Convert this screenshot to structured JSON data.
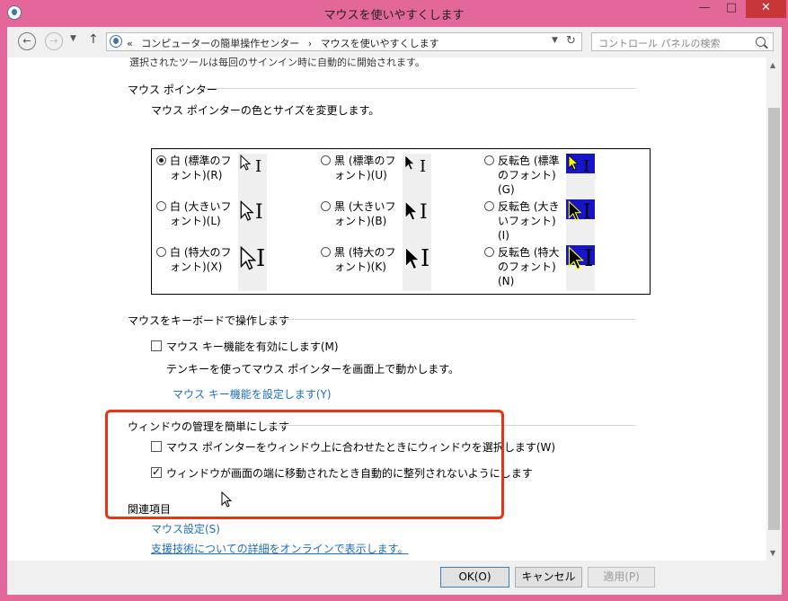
{
  "window": {
    "title": "マウスを使いやすくします",
    "controls": {
      "minimize": "—",
      "maximize": "□",
      "close": "✕"
    }
  },
  "address_bar": {
    "path_prefix": "«",
    "crumbs": [
      "コンピューターの簡単操作センター",
      "マウスを使いやすくします"
    ],
    "separator": "›",
    "search_placeholder": "コントロール パネルの検索"
  },
  "content": {
    "cut_text": "選択されたツールは毎回のサインイン時に自動的に開始されます。",
    "pointer_section": {
      "title": "マウス ポインター",
      "subtitle": "マウス ポインターの色とサイズを変更します。",
      "options": [
        {
          "label": "白 (標準のフォント)(R)",
          "selected": true
        },
        {
          "label": "黒 (標準のフォント)(U)",
          "selected": false
        },
        {
          "label": "反転色 (標準のフォント)(G)",
          "selected": false
        },
        {
          "label": "白 (大きいフォント)(L)",
          "selected": false
        },
        {
          "label": "黒 (大きいフォント)(B)",
          "selected": false
        },
        {
          "label": "反転色 (大きいフォント)(I)",
          "selected": false
        },
        {
          "label": "白 (特大のフォント)(X)",
          "selected": false
        },
        {
          "label": "黒 (特大のフォント)(K)",
          "selected": false
        },
        {
          "label": "反転色 (特大のフォント)(N)",
          "selected": false
        }
      ]
    },
    "keyboard_section": {
      "title": "マウスをキーボードで操作します",
      "mousekeys_label": "マウス キー機能を有効にします(M)",
      "mousekeys_checked": false,
      "desc": "テンキーを使ってマウス ポインターを画面上で動かします。",
      "link": "マウス キー機能を設定します(Y)"
    },
    "window_section": {
      "title": "ウィンドウの管理を簡単にします",
      "hover_activate_label": "マウス ポインターをウィンドウ上に合わせたときにウィンドウを選択します(W)",
      "hover_activate_checked": false,
      "prevent_arrange_label": "ウィンドウが画面の端に移動されたとき自動的に整列されないようにします",
      "prevent_arrange_checked": true
    },
    "related_section": {
      "title": "関連項目",
      "links": [
        "マウス設定(S)",
        "支援技術についての詳細をオンラインで表示します。"
      ]
    }
  },
  "buttons": {
    "ok": "OK(O)",
    "cancel": "キャンセル",
    "apply": "適用(P)"
  },
  "colors": {
    "highlight": "#e63418",
    "link": "#1e6fc1",
    "frame": "#e4679a",
    "inverted_bg": "#1616c8"
  }
}
